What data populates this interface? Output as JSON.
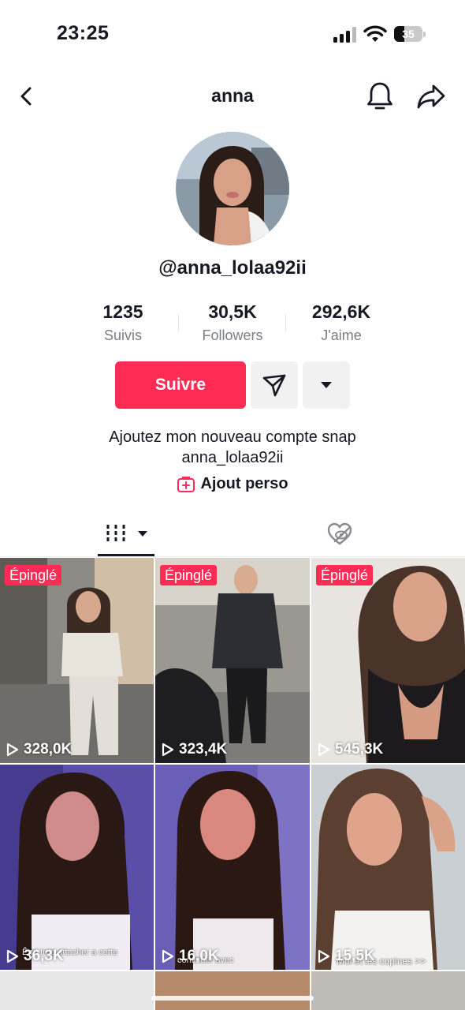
{
  "status_bar": {
    "time": "23:25",
    "battery_level": "35",
    "icons": [
      "cellular-signal-icon",
      "wifi-icon",
      "battery-icon"
    ]
  },
  "nav": {
    "title": "anna",
    "icons": [
      "back-icon",
      "bell-icon",
      "share-icon"
    ]
  },
  "profile": {
    "username": "@anna_lolaa92ii",
    "stats": [
      {
        "value": "1235",
        "label": "Suivis"
      },
      {
        "value": "30,5K",
        "label": "Followers"
      },
      {
        "value": "292,6K",
        "label": "J'aime"
      }
    ],
    "follow_label": "Suivre",
    "bio_line1": "Ajoutez mon nouveau compte snap",
    "bio_line2": "anna_lolaa92ii",
    "link_label": "Ajout perso"
  },
  "tabs": {
    "icons": [
      "videos-grid-icon",
      "liked-hidden-icon"
    ]
  },
  "grid": {
    "pinned_label": "Épinglé",
    "tiles": [
      {
        "views": "328,0K",
        "pinned": true
      },
      {
        "views": "323,4K",
        "pinned": true
      },
      {
        "views": "545,3K",
        "pinned": true
      },
      {
        "views": "36,3K",
        "pinned": false,
        "caption": "Être trop attacher a cette"
      },
      {
        "views": "16,0K",
        "pinned": false,
        "caption": "continuer avec"
      },
      {
        "views": "15,5K",
        "pinned": false,
        "caption": "Moi et les copines >>"
      }
    ]
  },
  "colors": {
    "accent": "#fe2c55",
    "text": "#161823",
    "secondary_text": "#7b7d85",
    "button_gray": "#f1f1f2"
  }
}
